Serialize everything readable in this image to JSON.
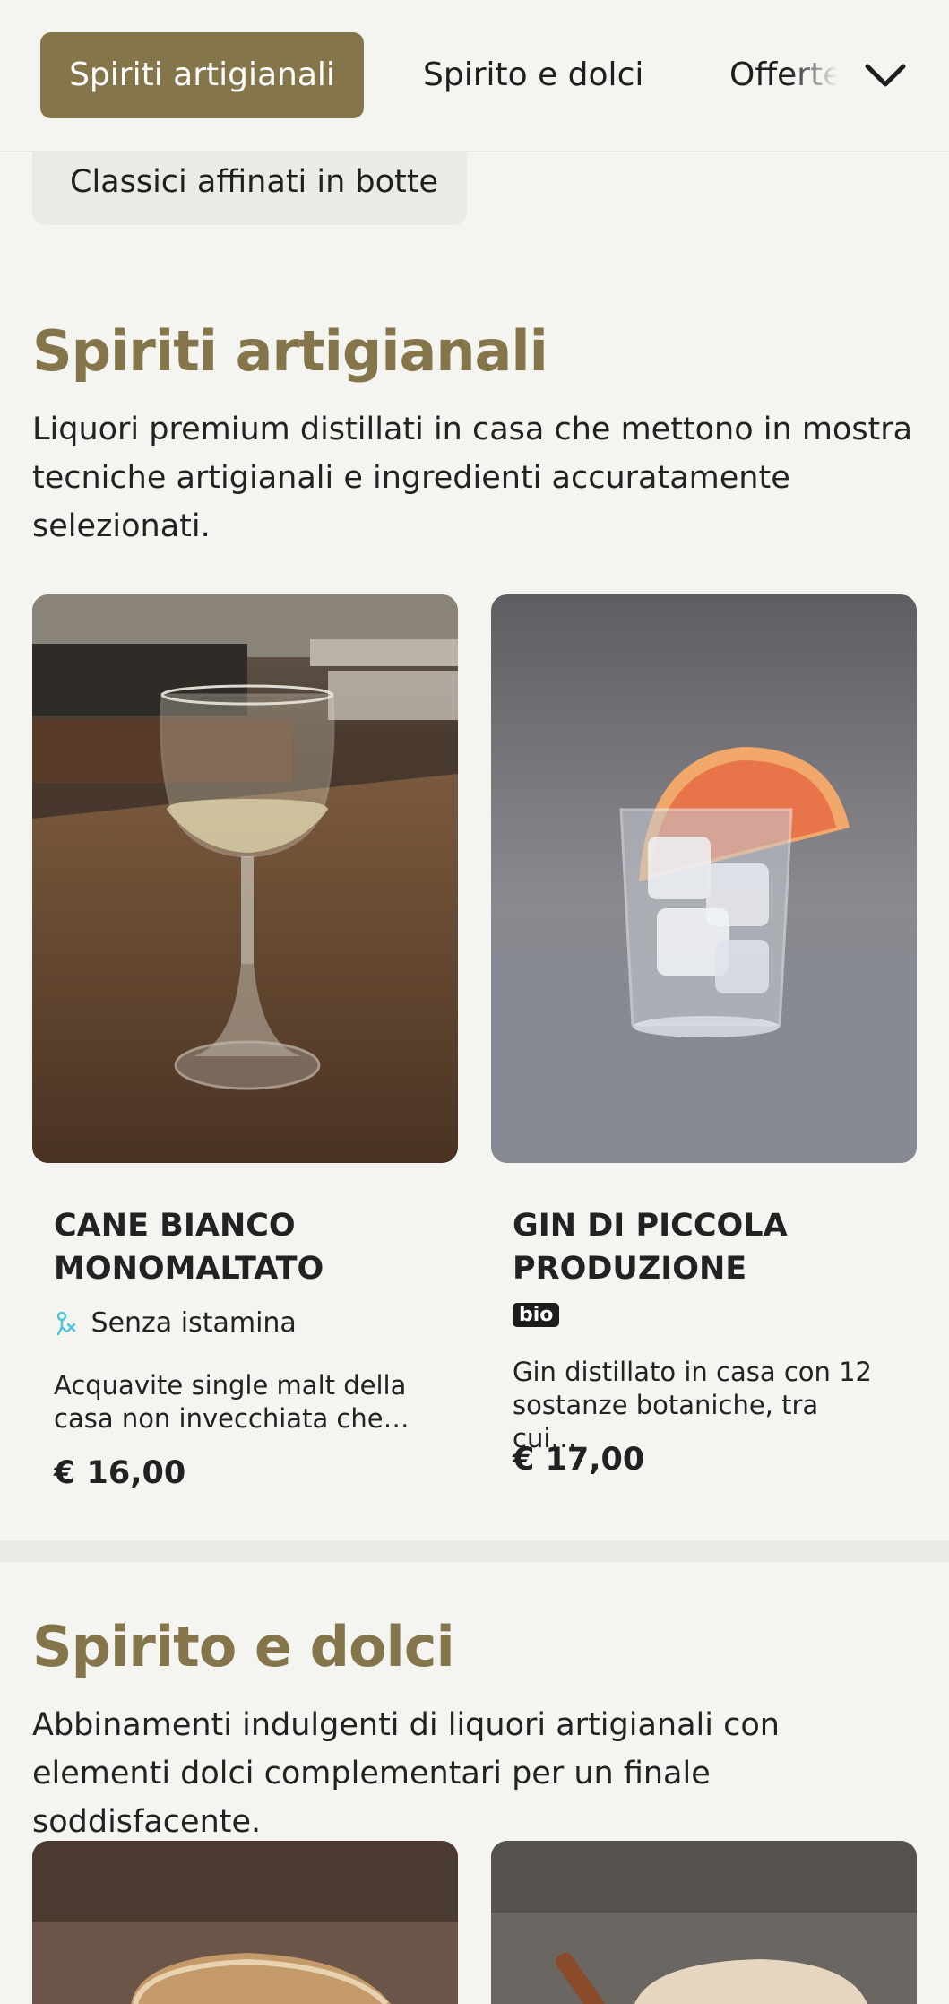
{
  "nav": {
    "tabs": [
      {
        "label": "Spiriti artigianali",
        "active": true
      },
      {
        "label": "Spirito e dolci",
        "active": false
      },
      {
        "label": "Offerte",
        "active": false
      }
    ],
    "expand_icon": "chevron-down-icon",
    "subchip_label": "Classici affinati in botte"
  },
  "sections": [
    {
      "title": "Spiriti artigianali",
      "description": "Liquori premium distillati in casa che mettono in mostra tecniche artigianali e ingredienti accuratamente selezionati.",
      "items": [
        {
          "name": "CANE BIANCO MONOMALTATO",
          "tag": "Senza istamina",
          "tag_icon": "histamine-free-icon",
          "description": "Acquavite single malt della casa non invecchiata che…",
          "price": "€ 16,00",
          "image": "wine-glass-photo"
        },
        {
          "name": "GIN DI PICCOLA PRODUZIONE",
          "tag": "bio",
          "description": "Gin distillato in casa con 12 sostanze botaniche, tra cui…",
          "price": "€ 17,00",
          "image": "gin-grapefruit-photo"
        }
      ]
    },
    {
      "title": "Spirito e dolci",
      "description": "Abbinamenti indulgenti di liquori artigianali con elementi dolci complementari per un finale soddisfacente.",
      "items": [
        {
          "image": "dessert-cocktail-photo"
        },
        {
          "image": "cinnamon-drink-photo"
        }
      ]
    }
  ],
  "colors": {
    "accent": "#85754a",
    "background": "#f4f4f0",
    "tag_icon": "#4fc3d9"
  }
}
